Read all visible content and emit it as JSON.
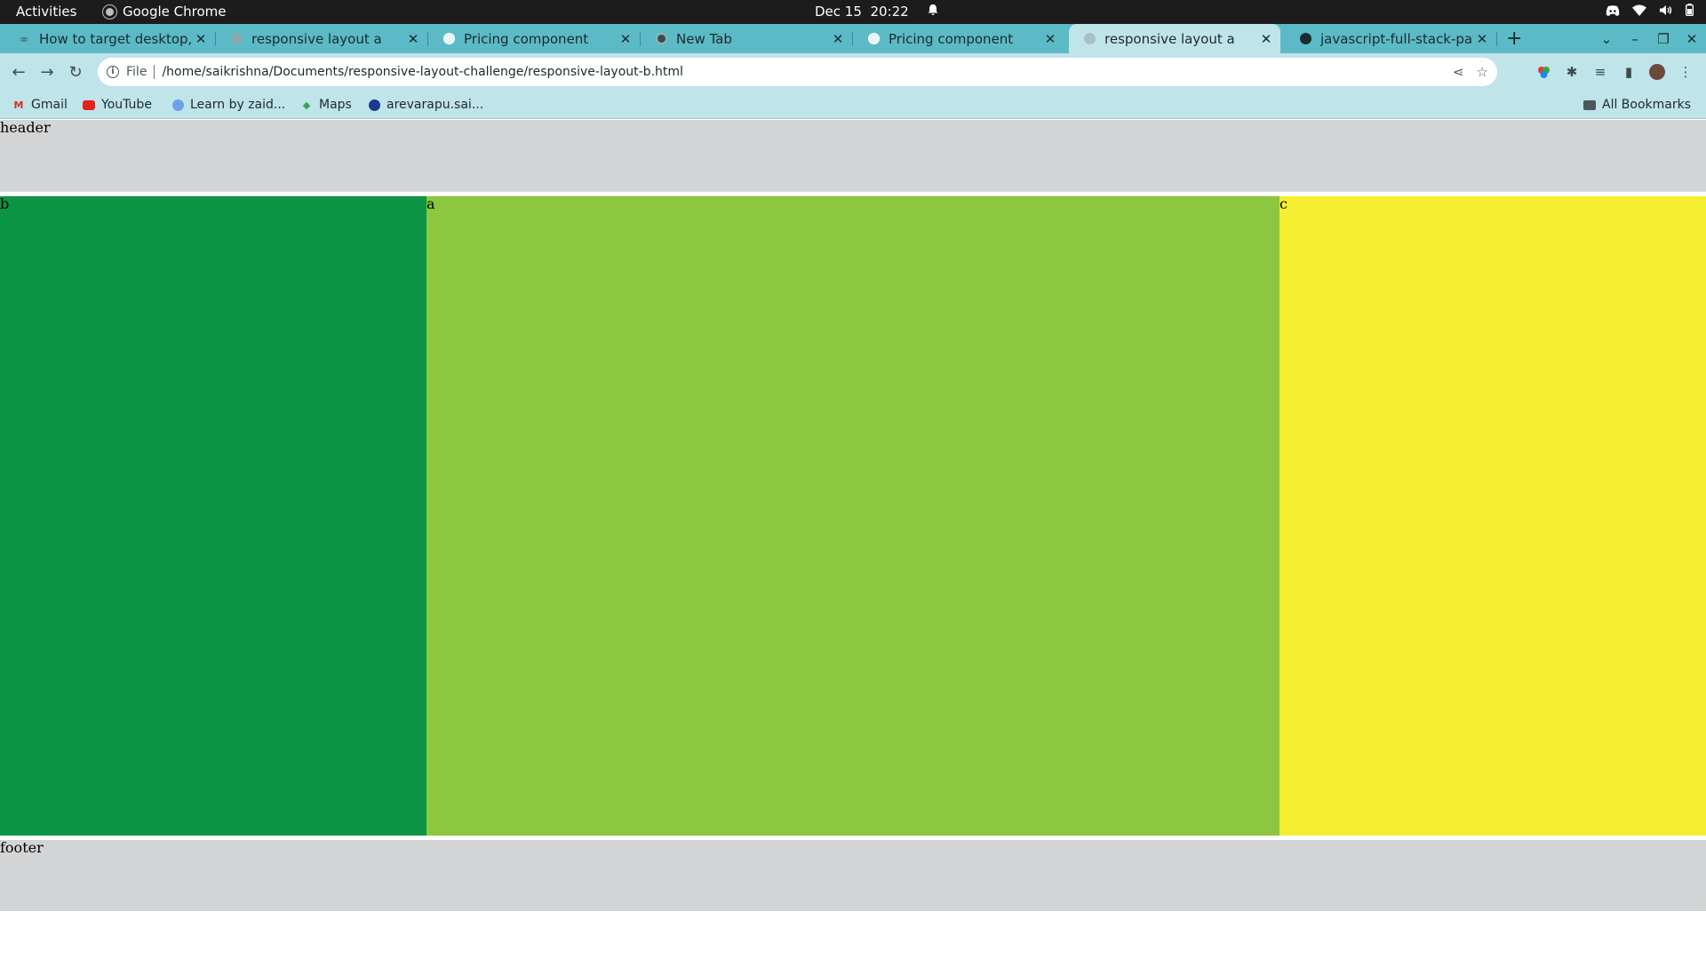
{
  "topbar": {
    "activities": "Activities",
    "app_name": "Google Chrome",
    "date": "Dec 15",
    "time": "20:22"
  },
  "tabs": [
    {
      "title": "How to target desktop, t",
      "active": false
    },
    {
      "title": "responsive layout a",
      "active": false
    },
    {
      "title": "Pricing component",
      "active": false
    },
    {
      "title": "New Tab",
      "active": false
    },
    {
      "title": "Pricing component",
      "active": false
    },
    {
      "title": "responsive layout a",
      "active": true
    },
    {
      "title": "javascript-full-stack-path",
      "active": false
    }
  ],
  "toolbar": {
    "scheme_label": "File",
    "url": "/home/saikrishna/Documents/responsive-layout-challenge/responsive-layout-b.html"
  },
  "bookmarks": {
    "items": [
      {
        "label": "Gmail"
      },
      {
        "label": "YouTube"
      },
      {
        "label": "Learn by zaid..."
      },
      {
        "label": "Maps"
      },
      {
        "label": "arevarapu.sai..."
      }
    ],
    "all_bookmarks": "All Bookmarks"
  },
  "page": {
    "header": "header",
    "b": "b",
    "a": "a",
    "c": "c",
    "footer": "footer"
  },
  "colors": {
    "tab_strip": "#5bbac6",
    "toolbar": "#bfe4ea",
    "header_footer": "#d3d4d6",
    "block_b": "#0b9544",
    "block_a": "#8dc63f",
    "block_c": "#f6ee31"
  }
}
